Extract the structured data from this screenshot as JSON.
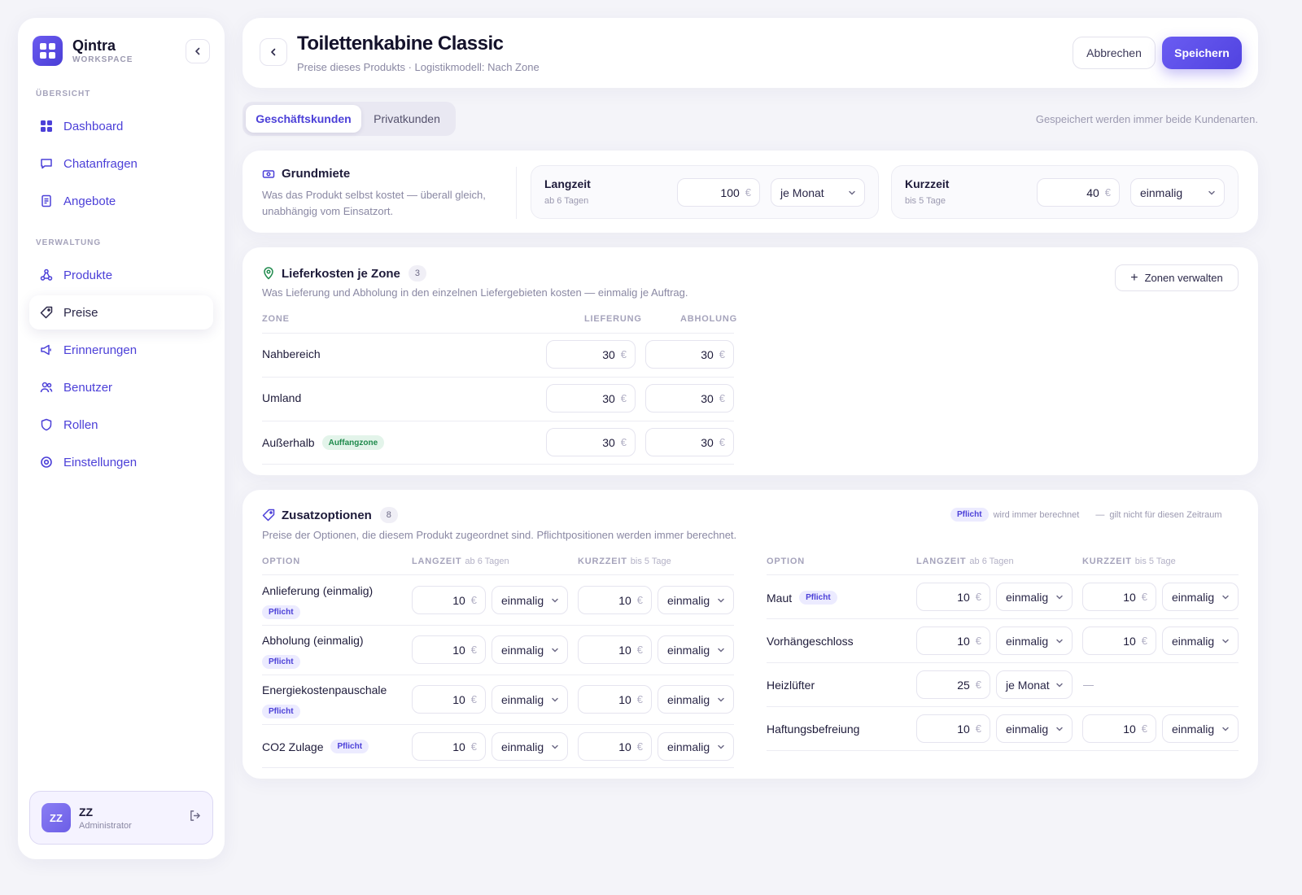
{
  "app": {
    "name": "Qintra",
    "subtitle": "WORKSPACE"
  },
  "sidebar": {
    "section1": "ÜBERSICHT",
    "section2": "VERWALTUNG",
    "items": [
      {
        "label": "Dashboard",
        "icon": "grid-icon"
      },
      {
        "label": "Chatanfragen",
        "icon": "chat-icon"
      },
      {
        "label": "Angebote",
        "icon": "document-icon"
      },
      {
        "label": "Produkte",
        "icon": "nodes-icon"
      },
      {
        "label": "Preise",
        "icon": "tag-icon",
        "active": true
      },
      {
        "label": "Erinnerungen",
        "icon": "megaphone-icon"
      },
      {
        "label": "Benutzer",
        "icon": "users-icon"
      },
      {
        "label": "Rollen",
        "icon": "shield-icon"
      },
      {
        "label": "Einstellungen",
        "icon": "settings-icon"
      }
    ],
    "user": {
      "initials": "ZZ",
      "name": "ZZ",
      "role": "Administrator"
    }
  },
  "header": {
    "title": "Toilettenkabine Classic",
    "subtitle": "Preise dieses Produkts · Logistikmodell: Nach Zone",
    "cancel": "Abbrechen",
    "save": "Speichern"
  },
  "tabs": {
    "active": "Geschäftskunden",
    "other": "Privatkunden",
    "note": "Gespeichert werden immer beide Kundenarten."
  },
  "grundmiete": {
    "title": "Grundmiete",
    "desc1": "Was das Produkt selbst kostet — überall gleich,",
    "desc2": "unabhängig vom Einsatzort.",
    "langzeit": {
      "label": "Langzeit",
      "sub": "ab 6 Tagen",
      "value": "100",
      "unit": "je Monat"
    },
    "kurzzeit": {
      "label": "Kurzzeit",
      "sub": "bis 5 Tage",
      "value": "40",
      "unit": "einmalig"
    }
  },
  "currency": "€",
  "liefer": {
    "title": "Lieferkosten je Zone",
    "count": "3",
    "desc": "Was Lieferung und Abholung in den einzelnen Liefergebieten kosten — einmalig je Auftrag.",
    "manage": "Zonen verwalten",
    "col_zone": "ZONE",
    "col_lief": "LIEFERUNG",
    "col_abh": "ABHOLUNG",
    "rows": [
      {
        "zone": "Nahbereich",
        "lief": "30",
        "abh": "30"
      },
      {
        "zone": "Umland",
        "lief": "30",
        "abh": "30"
      },
      {
        "zone": "Außerhalb",
        "badge": "Auffangzone",
        "lief": "30",
        "abh": "30"
      }
    ]
  },
  "zusatz": {
    "title": "Zusatzoptionen",
    "count": "8",
    "desc": "Preise der Optionen, die diesem Produkt zugeordnet sind. Pflichtpositionen werden immer berechnet.",
    "legend_badge": "Pflicht",
    "legend_text": "wird immer berechnet",
    "legend_dash": "—",
    "legend_text2": "gilt nicht für diesen Zeitraum",
    "col_option": "OPTION",
    "col_lang": "LANGZEIT",
    "col_lang_sub": "ab 6 Tagen",
    "col_kurz": "KURZZEIT",
    "col_kurz_sub": "bis 5 Tage",
    "pflicht": "Pflicht",
    "left": [
      {
        "name": "Anlieferung (einmalig)",
        "lval": "10",
        "lunit": "einmalig",
        "kval": "10",
        "kunit": "einmalig"
      },
      {
        "name": "Abholung (einmalig)",
        "lval": "10",
        "lunit": "einmalig",
        "kval": "10",
        "kunit": "einmalig"
      },
      {
        "name": "Energiekostenpauschale",
        "lval": "10",
        "lunit": "einmalig",
        "kval": "10",
        "kunit": "einmalig"
      },
      {
        "name": "CO2 Zulage",
        "lval": "10",
        "lunit": "einmalig",
        "kval": "10",
        "kunit": "einmalig"
      }
    ],
    "right": [
      {
        "name": "Maut",
        "lval": "10",
        "lunit": "einmalig",
        "kval": "10",
        "kunit": "einmalig"
      },
      {
        "name": "Vorhängeschloss",
        "lval": "10",
        "lunit": "einmalig",
        "kval": "10",
        "kunit": "einmalig"
      },
      {
        "name": "Heizlüfter",
        "lval": "25",
        "lunit": "je Monat",
        "kdash": "—"
      },
      {
        "name": "Haftungsbefreiung",
        "lval": "10",
        "lunit": "einmalig",
        "kval": "10",
        "kunit": "einmalig"
      }
    ]
  },
  "colors": {
    "accent": "#5143e0",
    "badge_green_bg": "#e3f4ea",
    "badge_green_fg": "#1f8a4c",
    "badge_purple_bg": "#ecebff"
  }
}
